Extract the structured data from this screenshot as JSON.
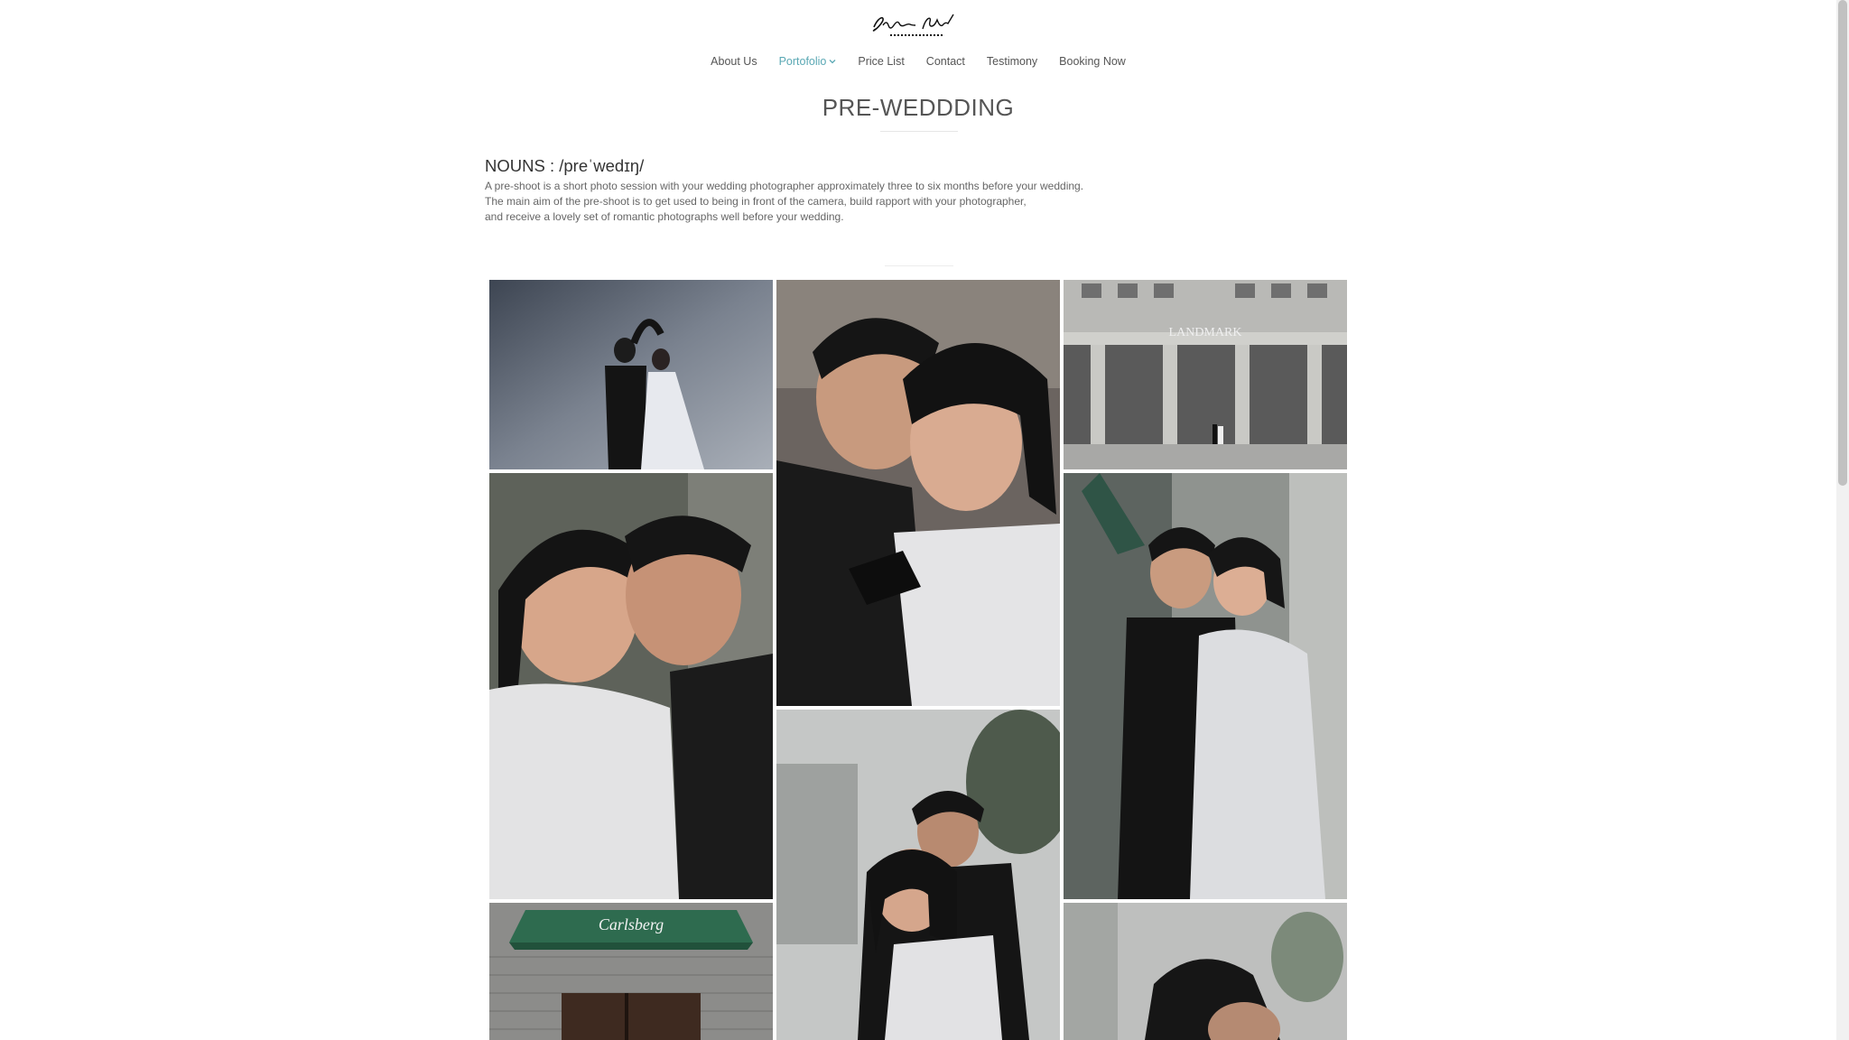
{
  "brand": {
    "logo_text": "SymphonyArt",
    "logo_sub": "PHOTOGRAPHY"
  },
  "nav": {
    "items": [
      {
        "label": "About Us"
      },
      {
        "label": "Portofolio",
        "active": true,
        "has_dropdown": true
      },
      {
        "label": "Price List"
      },
      {
        "label": "Contact"
      },
      {
        "label": "Testimony"
      },
      {
        "label": "Booking Now"
      }
    ]
  },
  "page": {
    "title": "PRE-WEDDDING",
    "nouns": "NOUNS : /preˈwedɪŋ/",
    "description": [
      "A pre-shoot is a short photo session with your wedding photographer approximately three to six months before your wedding.",
      "The main aim of the pre-shoot is to get used to being in front of the camera, build rapport with your photographer,",
      "and receive a lovely set of romantic photographs well before your wedding."
    ]
  },
  "gallery": {
    "photos": [
      {
        "name": "couple-heart-pose-photo",
        "sign_text": ""
      },
      {
        "name": "couple-closeup-embrace-photo",
        "sign_text": ""
      },
      {
        "name": "landmark-building-photo",
        "sign_text": "LANDMARK"
      },
      {
        "name": "couple-smiling-closeup-photo",
        "sign_text": ""
      },
      {
        "name": "couple-street-hug-photo",
        "sign_text": ""
      },
      {
        "name": "carlsberg-storefront-photo",
        "sign_text": "Carlsberg"
      },
      {
        "name": "couple-railway-photo",
        "sign_text": ""
      },
      {
        "name": "couple-street-closeup-photo",
        "sign_text": ""
      }
    ]
  },
  "colors": {
    "accent": "#5aa8b4",
    "text": "#555555"
  }
}
